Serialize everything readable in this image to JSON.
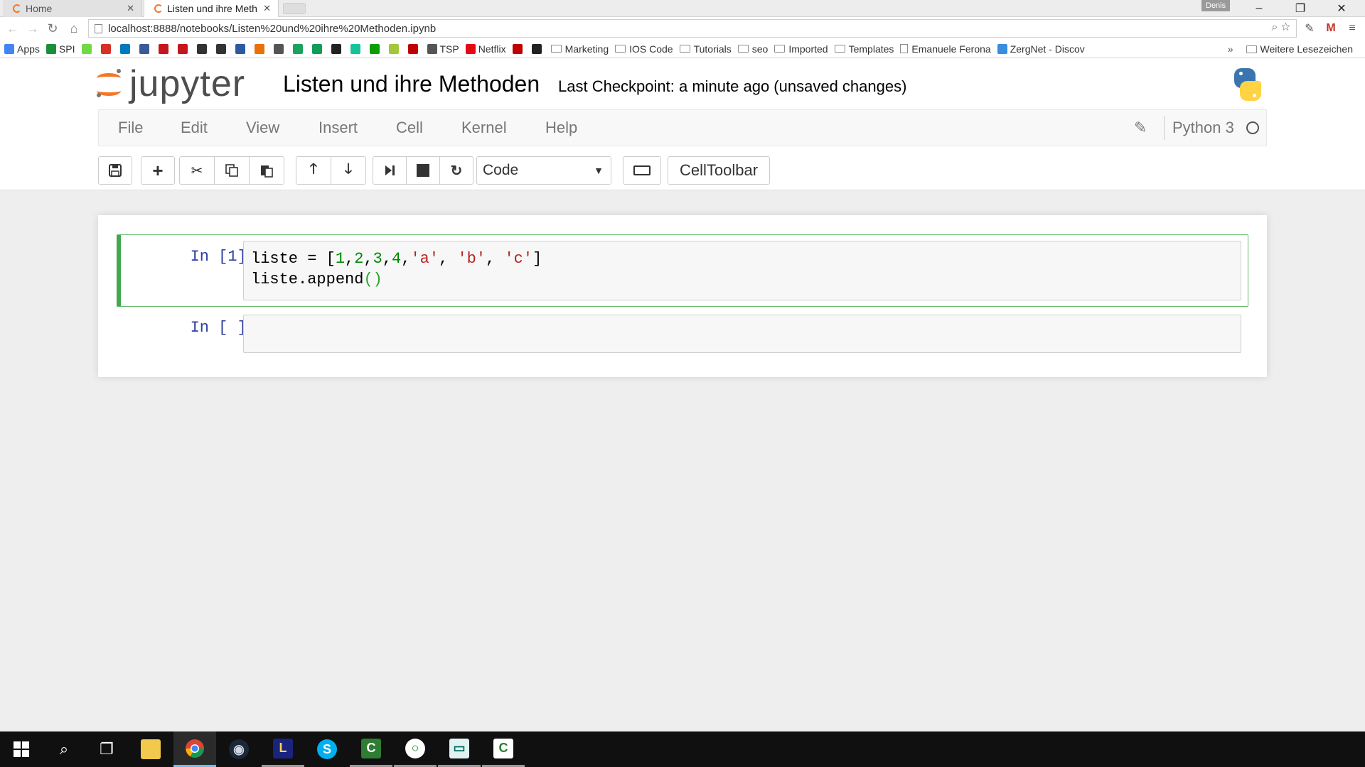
{
  "browser": {
    "tabs": [
      {
        "title": "Home",
        "active": false
      },
      {
        "title": "Listen und ihre Meth",
        "active": true
      }
    ],
    "user_badge": "Denis",
    "address": "localhost:8888/notebooks/Listen%20und%20ihre%20Methoden.ipynb",
    "bookmarks": [
      {
        "label": "Apps",
        "icon": "apps-grid-icon",
        "color": "#4285f4"
      },
      {
        "label": "SPI",
        "icon": "spi-icon",
        "color": "#1a8f3a"
      },
      {
        "label": "",
        "icon": "upwork-icon",
        "color": "#6fda44"
      },
      {
        "label": "",
        "icon": "bookmark-red-icon",
        "color": "#d93025"
      },
      {
        "label": "",
        "icon": "trello-icon",
        "color": "#0079bf"
      },
      {
        "label": "",
        "icon": "facebook-icon",
        "color": "#3b5998"
      },
      {
        "label": "",
        "icon": "kununu-icon",
        "color": "#c7151c"
      },
      {
        "label": "",
        "icon": "bookmark-red-icon",
        "color": "#c7151c"
      },
      {
        "label": "",
        "icon": "camera-icon",
        "color": "#333333"
      },
      {
        "label": "",
        "icon": "grid-icon",
        "color": "#333333"
      },
      {
        "label": "",
        "icon": "blue-star-icon",
        "color": "#2c5aa0"
      },
      {
        "label": "",
        "icon": "four-icon",
        "color": "#e8710a"
      },
      {
        "label": "",
        "icon": "at-icon",
        "color": "#555555"
      },
      {
        "label": "",
        "icon": "q-icon",
        "color": "#1aa260"
      },
      {
        "label": "",
        "icon": "drive-icon",
        "color": "#0f9d58"
      },
      {
        "label": "",
        "icon": "e-icon",
        "color": "#222222"
      },
      {
        "label": "",
        "icon": "grammarly-icon",
        "color": "#15c39a"
      },
      {
        "label": "",
        "icon": "tc-icon",
        "color": "#0a9e01"
      },
      {
        "label": "",
        "icon": "android-icon",
        "color": "#a4c639"
      },
      {
        "label": "",
        "icon": "sn-icon",
        "color": "#c00000"
      },
      {
        "label": "TSP",
        "icon": "tsp-icon",
        "color": "#555555"
      },
      {
        "label": "Netflix",
        "icon": "netflix-icon",
        "color": "#e50914"
      },
      {
        "label": "",
        "icon": "anchor-icon",
        "color": "#c00000"
      },
      {
        "label": "",
        "icon": "play-icon",
        "color": "#222222"
      },
      {
        "label": "Marketing",
        "icon": "folder-icon",
        "color": "#8d8d8d"
      },
      {
        "label": "IOS Code",
        "icon": "folder-icon",
        "color": "#8d8d8d"
      },
      {
        "label": "Tutorials",
        "icon": "folder-icon",
        "color": "#8d8d8d"
      },
      {
        "label": "seo",
        "icon": "folder-icon",
        "color": "#8d8d8d"
      },
      {
        "label": "Imported",
        "icon": "folder-icon",
        "color": "#8d8d8d"
      },
      {
        "label": "Templates",
        "icon": "folder-icon",
        "color": "#8d8d8d"
      },
      {
        "label": "Emanuele Ferona",
        "icon": "page-icon",
        "color": "#8d8d8d"
      },
      {
        "label": "ZergNet - Discov",
        "icon": "zergnet-icon",
        "color": "#3a8dde"
      }
    ],
    "bookmarks_more": "»",
    "other_bookmarks": "Weitere Lesezeichen"
  },
  "jupyter": {
    "logo_text": "jupyter",
    "notebook_title": "Listen und ihre Methoden",
    "checkpoint": "Last Checkpoint: a minute ago (unsaved changes)",
    "menu": [
      "File",
      "Edit",
      "View",
      "Insert",
      "Cell",
      "Kernel",
      "Help"
    ],
    "kernel_name": "Python 3",
    "cell_type": "Code",
    "celltoolbar_label": "CellToolbar"
  },
  "cells": [
    {
      "prompt": "In [1]:",
      "lines": [
        {
          "var": "liste",
          "op": " = [",
          "n1": "1",
          "n2": "2",
          "n3": "3",
          "n4": "4",
          "s1": "'a'",
          "s2": "'b'",
          "s3": "'c'",
          "close": "]"
        },
        {
          "obj": "liste",
          "dot": ".",
          "method": "append",
          "paren": "()"
        }
      ],
      "selected": true
    },
    {
      "prompt": "In [ ]:",
      "lines": [],
      "selected": false
    }
  ],
  "colors": {
    "jupyter_orange": "#f37726",
    "prompt_blue": "#303f9f",
    "selected_cell_border": "#42a84d",
    "number_green": "#008800",
    "string_red": "#ba2121"
  },
  "taskbar": {
    "items": [
      "windows-start-icon",
      "search-icon",
      "task-view-icon",
      "file-explorer-icon",
      "chrome-icon",
      "steam-icon",
      "app-l-icon",
      "skype-icon",
      "camtasia-icon",
      "green-circle-app-icon",
      "screen-app-icon",
      "camtasia-recorder-icon"
    ]
  }
}
